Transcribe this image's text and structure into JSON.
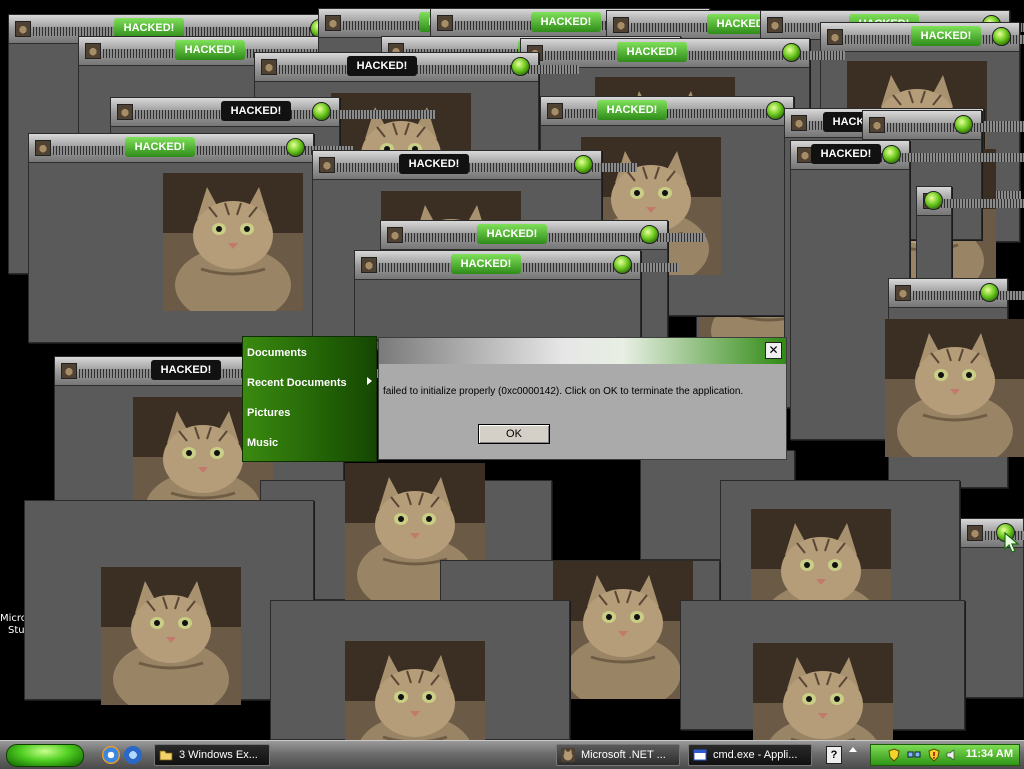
{
  "popup_window": {
    "title_tag": "HACKED!"
  },
  "desktop": {
    "icon_labels": [
      "Micro",
      "Stu"
    ]
  },
  "start_menu": {
    "items": [
      "Documents",
      "Recent Documents",
      "Pictures",
      "Music"
    ]
  },
  "error_dialog": {
    "close_glyph": "✕",
    "message": "failed to initialize properly (0xc0000142). Click on OK to terminate the application.",
    "ok_label": "OK"
  },
  "taskbar": {
    "buttons": [
      {
        "label": "3 Windows Ex...",
        "icon": "folder-icon"
      },
      {
        "label": "Microsoft .NET ...",
        "icon": "cat-icon"
      },
      {
        "label": "cmd.exe - Appli...",
        "icon": "window-icon"
      }
    ],
    "clock": "11:34 AM",
    "help_glyph": "?"
  },
  "colors": {
    "taskbar_green": "#3fa31c",
    "hacked_green": "#4cc02a",
    "window_gray": "#5a5a5a"
  }
}
